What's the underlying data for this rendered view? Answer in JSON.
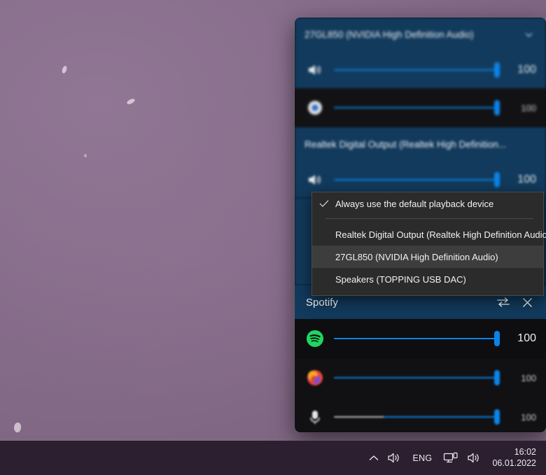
{
  "desktop": {
    "wallpaper_color": "#8a6f8a"
  },
  "taskbar": {
    "background_color": "#2b1f30",
    "show_hidden_icons_label": "",
    "language": "ENG",
    "time": "16:02",
    "date": "06.01.2022"
  },
  "volume_panel": {
    "accent_color": "#0a84e8",
    "selected_background": "#123A5C",
    "devices": [
      {
        "title": "27GL850 (NVIDIA High Definition Audio)",
        "selected": true,
        "master": {
          "icon": "speaker-icon",
          "value": "100",
          "percent": 100
        },
        "apps": [
          {
            "icon": "chrome-icon",
            "value": "100",
            "percent": 100
          }
        ]
      },
      {
        "title": "Realtek Digital Output (Realtek High Definition...",
        "selected": true,
        "master": {
          "icon": "speaker-icon",
          "value": "100",
          "percent": 100
        },
        "apps": []
      }
    ],
    "spotify": {
      "title": "Spotify",
      "move_icon": "swap-device-icon",
      "close_icon": "close-icon",
      "value": "100",
      "percent": 100,
      "icon": "spotify-icon"
    },
    "extra_apps": [
      {
        "icon": "firefox-icon",
        "value": "100",
        "percent": 100,
        "muted": false
      },
      {
        "icon": "microphone-icon",
        "value": "100",
        "percent": 100,
        "muted": true
      }
    ]
  },
  "device_menu": {
    "items": [
      {
        "label": "Always use the default playback device",
        "checked": true,
        "highlighted": false
      },
      {
        "label": "Realtek Digital Output (Realtek High Definition Audio)",
        "checked": false,
        "highlighted": false
      },
      {
        "label": "27GL850 (NVIDIA High Definition Audio)",
        "checked": false,
        "highlighted": true
      },
      {
        "label": "Speakers (TOPPING USB DAC)",
        "checked": false,
        "highlighted": false
      }
    ]
  }
}
